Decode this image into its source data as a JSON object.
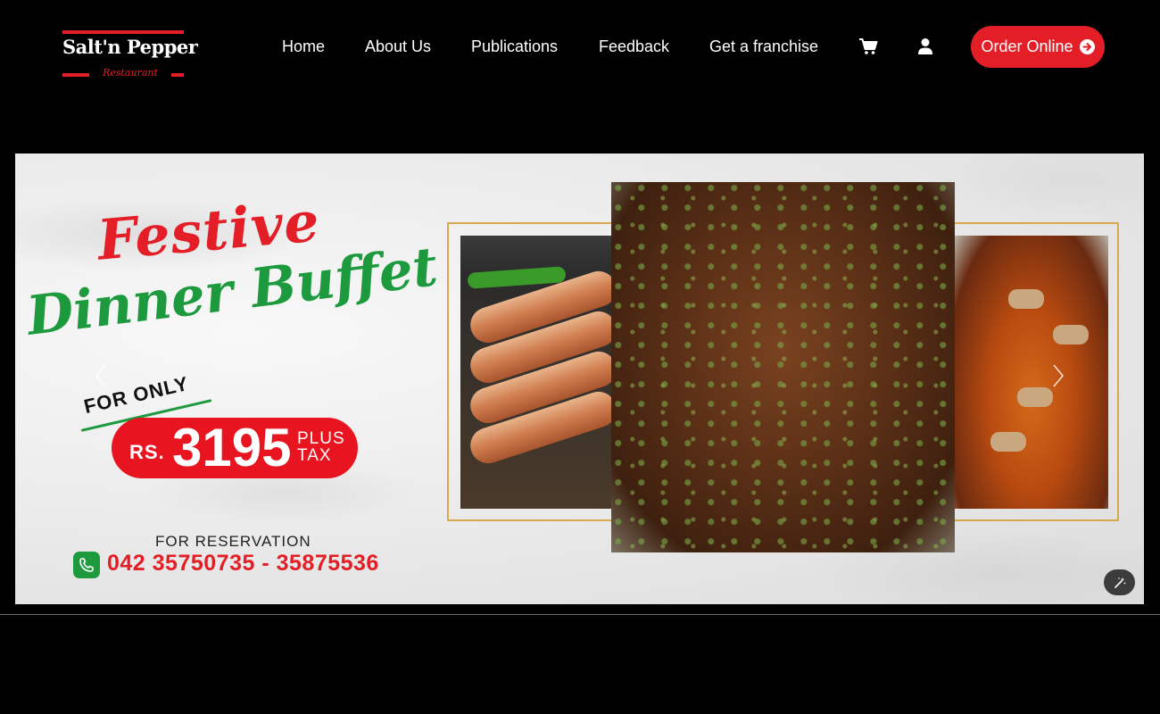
{
  "header": {
    "logo": {
      "brand": "Salt'n Pepper",
      "sub": "Restaurant"
    },
    "nav": [
      {
        "label": "Home"
      },
      {
        "label": "About Us"
      },
      {
        "label": "Publications"
      },
      {
        "label": "Feedback"
      },
      {
        "label": "Get a franchise"
      }
    ],
    "icons": [
      "cart-icon",
      "user-icon"
    ],
    "order_button": {
      "label": "Order Online",
      "icon": "arrow-right-circle-icon"
    }
  },
  "banner": {
    "title_line1": "Festive",
    "title_line2": "Dinner Buffet",
    "for_only": "FOR ONLY",
    "price": {
      "currency": "RS.",
      "amount": "3195",
      "plus": "PLUS",
      "tax": "TAX"
    },
    "reservation_label": "FOR RESERVATION",
    "phone": "042 35750735 - 35875536",
    "prev_icon": "chevron-left-icon",
    "next_icon": "chevron-right-icon",
    "magic_icon": "magic-wand-icon"
  },
  "colors": {
    "brand_red": "#e41e26",
    "brand_green": "#1d9a3e",
    "gold_frame": "#d7a850",
    "background": "#000000"
  }
}
